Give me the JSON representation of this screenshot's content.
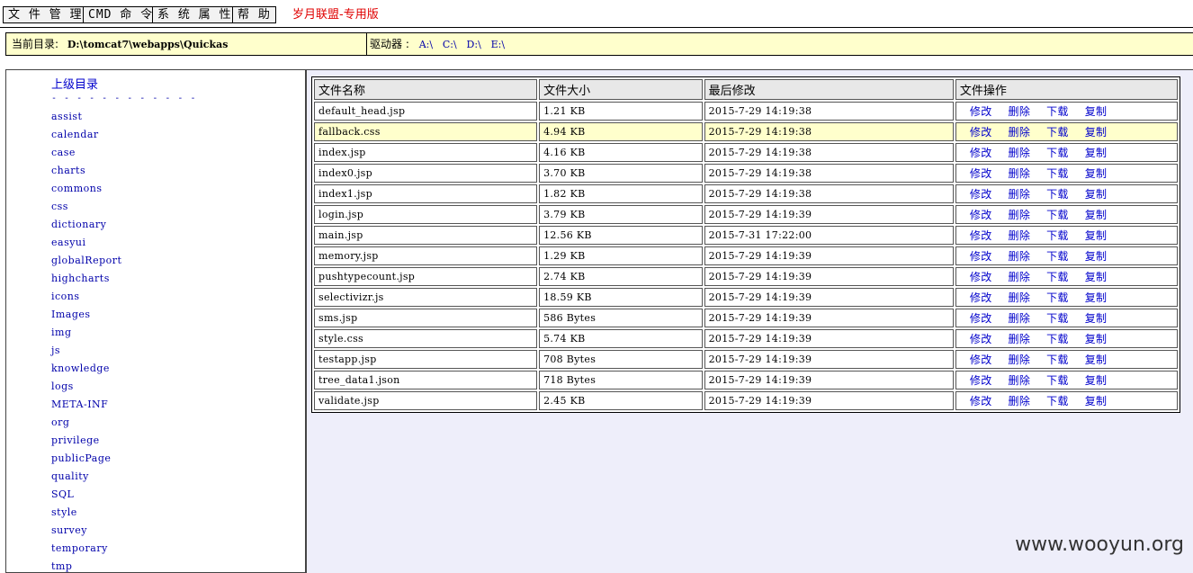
{
  "menu": {
    "file_manage": "文 件 管 理",
    "cmd": "CMD 命 令",
    "sys_props": "系 统 属 性",
    "help": "帮 助",
    "brand": "岁月联盟-专用版"
  },
  "pathbar": {
    "cur_dir_label": "当前目录:",
    "cur_dir_value": "D:\\tomcat7\\webapps\\Quickas",
    "drives_label": "驱动器 :",
    "drives": [
      "A:\\",
      "C:\\",
      "D:\\",
      "E:\\"
    ]
  },
  "sidebar": {
    "parent_label": "上级目录",
    "dashes": "- - - - - - - - - - - -",
    "dirs": [
      "assist",
      "calendar",
      "case",
      "charts",
      "commons",
      "css",
      "dictionary",
      "easyui",
      "globalReport",
      "highcharts",
      "icons",
      "Images",
      "img",
      "js",
      "knowledge",
      "logs",
      "META-INF",
      "org",
      "privilege",
      "publicPage",
      "quality",
      "SQL",
      "style",
      "survey",
      "temporary",
      "tmp"
    ]
  },
  "table": {
    "headers": [
      "文件名称",
      "文件大小",
      "最后修改",
      "文件操作"
    ],
    "ops": [
      "修改",
      "删除",
      "下载",
      "复制"
    ],
    "rows": [
      {
        "name": "default_head.jsp",
        "size": "1.21 KB",
        "modified": "2015-7-29 14:19:38"
      },
      {
        "name": "fallback.css",
        "size": "4.94 KB",
        "modified": "2015-7-29 14:19:38",
        "highlight": true
      },
      {
        "name": "index.jsp",
        "size": "4.16 KB",
        "modified": "2015-7-29 14:19:38"
      },
      {
        "name": "index0.jsp",
        "size": "3.70 KB",
        "modified": "2015-7-29 14:19:38"
      },
      {
        "name": "index1.jsp",
        "size": "1.82 KB",
        "modified": "2015-7-29 14:19:38"
      },
      {
        "name": "login.jsp",
        "size": "3.79 KB",
        "modified": "2015-7-29 14:19:39"
      },
      {
        "name": "main.jsp",
        "size": "12.56 KB",
        "modified": "2015-7-31 17:22:00"
      },
      {
        "name": "memory.jsp",
        "size": "1.29 KB",
        "modified": "2015-7-29 14:19:39"
      },
      {
        "name": "pushtypecount.jsp",
        "size": "2.74 KB",
        "modified": "2015-7-29 14:19:39"
      },
      {
        "name": "selectivizr.js",
        "size": "18.59 KB",
        "modified": "2015-7-29 14:19:39"
      },
      {
        "name": "sms.jsp",
        "size": "586 Bytes",
        "modified": "2015-7-29 14:19:39"
      },
      {
        "name": "style.css",
        "size": "5.74 KB",
        "modified": "2015-7-29 14:19:39"
      },
      {
        "name": "testapp.jsp",
        "size": "708 Bytes",
        "modified": "2015-7-29 14:19:39"
      },
      {
        "name": "tree_data1.json",
        "size": "718 Bytes",
        "modified": "2015-7-29 14:19:39"
      },
      {
        "name": "validate.jsp",
        "size": "2.45 KB",
        "modified": "2015-7-29 14:19:39"
      }
    ]
  },
  "watermark": "www.wooyun.org"
}
